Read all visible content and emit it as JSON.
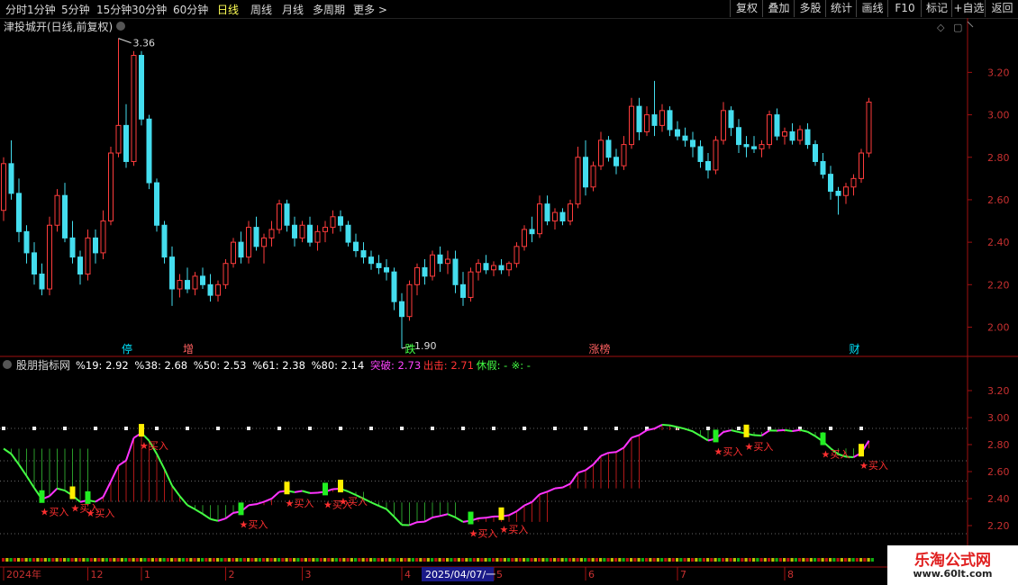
{
  "toolbar": {
    "periods": [
      "分时",
      "1分钟",
      "5分钟",
      "15分钟",
      "30分钟",
      "60分钟",
      "日线",
      "周线",
      "月线",
      "多周期",
      "更多 >"
    ],
    "active_period": "日线",
    "buttons": [
      "复权",
      "叠加",
      "多股",
      "统计",
      "画线",
      "F10",
      "标记",
      "+自选",
      "返回"
    ]
  },
  "main_title": "津投城开(日线,前复权)",
  "price_axis": [
    "3.20",
    "3.00",
    "2.80",
    "2.60",
    "2.40",
    "2.20",
    "2.00"
  ],
  "high_label": "3.36",
  "low_label": "1.90",
  "event_markers": [
    {
      "text": "停",
      "color": "#00e5ff",
      "bar": 16
    },
    {
      "text": "增",
      "color": "#ff6060",
      "bar": 24
    },
    {
      "text": "跌",
      "color": "#44ff44",
      "bar": 53
    },
    {
      "text": "涨榜",
      "color": "#ff6060",
      "bar": 77
    },
    {
      "text": "财",
      "color": "#00e5ff",
      "bar": 111
    }
  ],
  "indicator": {
    "name": "股朋指标网",
    "values": [
      {
        "text": "%19: 2.92",
        "color": "#ffffff"
      },
      {
        "text": "%38: 2.68",
        "color": "#ffffff"
      },
      {
        "text": "%50: 2.53",
        "color": "#ffffff"
      },
      {
        "text": "%61: 2.38",
        "color": "#ffffff"
      },
      {
        "text": "%80: 2.14",
        "color": "#ffffff"
      },
      {
        "text": "突破: 2.73",
        "color": "#ff44ff"
      },
      {
        "text": "出击: 2.71",
        "color": "#ff3333"
      },
      {
        "text": "休假: -",
        "color": "#44ff44"
      },
      {
        "text": "※: -",
        "color": "#44ff44"
      }
    ],
    "axis": [
      "3.20",
      "3.00",
      "2.80",
      "2.60",
      "2.40",
      "2.20"
    ],
    "buy_label": "买入",
    "buy_bars": [
      5,
      9,
      11,
      18,
      31,
      37,
      42,
      44,
      61,
      65,
      93,
      97,
      107,
      112,
      114,
      121
    ]
  },
  "time_axis": [
    {
      "text": "2024年",
      "bar": 0
    },
    {
      "text": "12",
      "bar": 11
    },
    {
      "text": "1",
      "bar": 18
    },
    {
      "text": "2",
      "bar": 29
    },
    {
      "text": "3",
      "bar": 39
    },
    {
      "text": "4",
      "bar": 52
    },
    {
      "text": "5",
      "bar": 64
    },
    {
      "text": "6",
      "bar": 76
    },
    {
      "text": "7",
      "bar": 88
    },
    {
      "text": "8",
      "bar": 102
    }
  ],
  "cursor_date": "2025/04/07/一",
  "watermark": {
    "title": "乐淘公式网",
    "url": "www.60lt.com"
  },
  "chart_data": {
    "type": "candlestick",
    "symbol": "津投城开",
    "ylim": [
      1.93,
      3.35
    ],
    "ohlc": [
      [
        2.55,
        2.8,
        2.5,
        2.77
      ],
      [
        2.77,
        2.88,
        2.6,
        2.63
      ],
      [
        2.63,
        2.7,
        2.4,
        2.45
      ],
      [
        2.45,
        2.48,
        2.3,
        2.35
      ],
      [
        2.35,
        2.4,
        2.2,
        2.25
      ],
      [
        2.25,
        2.3,
        2.15,
        2.18
      ],
      [
        2.18,
        2.52,
        2.15,
        2.48
      ],
      [
        2.48,
        2.65,
        2.45,
        2.62
      ],
      [
        2.62,
        2.68,
        2.4,
        2.42
      ],
      [
        2.42,
        2.5,
        2.3,
        2.33
      ],
      [
        2.33,
        2.36,
        2.2,
        2.25
      ],
      [
        2.25,
        2.46,
        2.22,
        2.42
      ],
      [
        2.42,
        2.46,
        2.3,
        2.35
      ],
      [
        2.35,
        2.55,
        2.32,
        2.5
      ],
      [
        2.5,
        2.85,
        2.48,
        2.82
      ],
      [
        2.82,
        3.36,
        2.8,
        2.95
      ],
      [
        2.95,
        3.05,
        2.75,
        2.78
      ],
      [
        2.78,
        3.3,
        2.76,
        3.28
      ],
      [
        3.28,
        3.3,
        2.95,
        2.98
      ],
      [
        2.98,
        3.0,
        2.65,
        2.68
      ],
      [
        2.68,
        2.7,
        2.45,
        2.48
      ],
      [
        2.48,
        2.5,
        2.3,
        2.33
      ],
      [
        2.33,
        2.38,
        2.1,
        2.18
      ],
      [
        2.18,
        2.25,
        2.14,
        2.22
      ],
      [
        2.22,
        2.28,
        2.16,
        2.18
      ],
      [
        2.18,
        2.26,
        2.15,
        2.24
      ],
      [
        2.24,
        2.28,
        2.18,
        2.2
      ],
      [
        2.2,
        2.25,
        2.12,
        2.15
      ],
      [
        2.15,
        2.22,
        2.12,
        2.2
      ],
      [
        2.2,
        2.32,
        2.18,
        2.3
      ],
      [
        2.3,
        2.42,
        2.28,
        2.4
      ],
      [
        2.4,
        2.45,
        2.3,
        2.33
      ],
      [
        2.33,
        2.5,
        2.3,
        2.47
      ],
      [
        2.47,
        2.52,
        2.36,
        2.38
      ],
      [
        2.38,
        2.44,
        2.3,
        2.42
      ],
      [
        2.42,
        2.5,
        2.38,
        2.46
      ],
      [
        2.46,
        2.6,
        2.44,
        2.58
      ],
      [
        2.58,
        2.6,
        2.45,
        2.48
      ],
      [
        2.48,
        2.52,
        2.38,
        2.42
      ],
      [
        2.42,
        2.5,
        2.4,
        2.48
      ],
      [
        2.48,
        2.52,
        2.38,
        2.4
      ],
      [
        2.4,
        2.48,
        2.36,
        2.45
      ],
      [
        2.45,
        2.5,
        2.4,
        2.47
      ],
      [
        2.47,
        2.55,
        2.44,
        2.52
      ],
      [
        2.52,
        2.55,
        2.45,
        2.48
      ],
      [
        2.48,
        2.5,
        2.38,
        2.4
      ],
      [
        2.4,
        2.44,
        2.33,
        2.36
      ],
      [
        2.36,
        2.4,
        2.3,
        2.33
      ],
      [
        2.33,
        2.36,
        2.27,
        2.3
      ],
      [
        2.3,
        2.34,
        2.25,
        2.28
      ],
      [
        2.28,
        2.32,
        2.22,
        2.26
      ],
      [
        2.26,
        2.28,
        2.08,
        2.12
      ],
      [
        2.12,
        2.16,
        1.9,
        2.05
      ],
      [
        2.05,
        2.22,
        2.03,
        2.2
      ],
      [
        2.2,
        2.3,
        2.15,
        2.28
      ],
      [
        2.28,
        2.32,
        2.2,
        2.24
      ],
      [
        2.24,
        2.36,
        2.22,
        2.34
      ],
      [
        2.34,
        2.38,
        2.26,
        2.3
      ],
      [
        2.3,
        2.36,
        2.25,
        2.32
      ],
      [
        2.32,
        2.36,
        2.16,
        2.2
      ],
      [
        2.2,
        2.26,
        2.1,
        2.14
      ],
      [
        2.14,
        2.28,
        2.12,
        2.26
      ],
      [
        2.26,
        2.32,
        2.22,
        2.3
      ],
      [
        2.3,
        2.34,
        2.25,
        2.27
      ],
      [
        2.27,
        2.31,
        2.24,
        2.29
      ],
      [
        2.29,
        2.32,
        2.25,
        2.27
      ],
      [
        2.27,
        2.31,
        2.24,
        2.3
      ],
      [
        2.3,
        2.4,
        2.28,
        2.38
      ],
      [
        2.38,
        2.48,
        2.36,
        2.46
      ],
      [
        2.46,
        2.52,
        2.4,
        2.44
      ],
      [
        2.44,
        2.62,
        2.42,
        2.58
      ],
      [
        2.58,
        2.62,
        2.48,
        2.5
      ],
      [
        2.5,
        2.56,
        2.46,
        2.54
      ],
      [
        2.54,
        2.56,
        2.48,
        2.5
      ],
      [
        2.5,
        2.6,
        2.48,
        2.58
      ],
      [
        2.58,
        2.85,
        2.56,
        2.8
      ],
      [
        2.8,
        2.88,
        2.62,
        2.66
      ],
      [
        2.66,
        2.78,
        2.64,
        2.76
      ],
      [
        2.76,
        2.92,
        2.74,
        2.88
      ],
      [
        2.88,
        2.9,
        2.78,
        2.8
      ],
      [
        2.8,
        2.84,
        2.72,
        2.76
      ],
      [
        2.76,
        2.9,
        2.74,
        2.86
      ],
      [
        2.86,
        3.08,
        2.84,
        3.04
      ],
      [
        3.04,
        3.08,
        2.88,
        2.92
      ],
      [
        2.92,
        3.04,
        2.9,
        3.0
      ],
      [
        3.0,
        3.16,
        2.9,
        2.95
      ],
      [
        2.95,
        3.05,
        2.92,
        3.02
      ],
      [
        3.02,
        3.04,
        2.9,
        2.93
      ],
      [
        2.93,
        2.97,
        2.88,
        2.9
      ],
      [
        2.9,
        2.94,
        2.85,
        2.88
      ],
      [
        2.88,
        2.92,
        2.8,
        2.85
      ],
      [
        2.85,
        2.88,
        2.75,
        2.78
      ],
      [
        2.78,
        2.82,
        2.7,
        2.74
      ],
      [
        2.74,
        2.9,
        2.72,
        2.88
      ],
      [
        2.88,
        3.06,
        2.86,
        3.02
      ],
      [
        3.02,
        3.04,
        2.9,
        2.94
      ],
      [
        2.94,
        2.98,
        2.82,
        2.86
      ],
      [
        2.86,
        2.9,
        2.8,
        2.85
      ],
      [
        2.85,
        2.9,
        2.82,
        2.84
      ],
      [
        2.84,
        2.88,
        2.8,
        2.86
      ],
      [
        2.86,
        3.02,
        2.84,
        3.0
      ],
      [
        3.0,
        3.03,
        2.88,
        2.9
      ],
      [
        2.9,
        2.94,
        2.86,
        2.92
      ],
      [
        2.92,
        2.96,
        2.86,
        2.88
      ],
      [
        2.88,
        2.95,
        2.86,
        2.93
      ],
      [
        2.93,
        2.96,
        2.84,
        2.86
      ],
      [
        2.86,
        2.88,
        2.76,
        2.78
      ],
      [
        2.78,
        2.82,
        2.7,
        2.72
      ],
      [
        2.72,
        2.76,
        2.6,
        2.64
      ],
      [
        2.64,
        2.66,
        2.53,
        2.62
      ],
      [
        2.62,
        2.68,
        2.58,
        2.66
      ],
      [
        2.66,
        2.72,
        2.62,
        2.7
      ],
      [
        2.7,
        2.84,
        2.68,
        2.82
      ],
      [
        2.82,
        3.08,
        2.8,
        3.06
      ]
    ]
  }
}
